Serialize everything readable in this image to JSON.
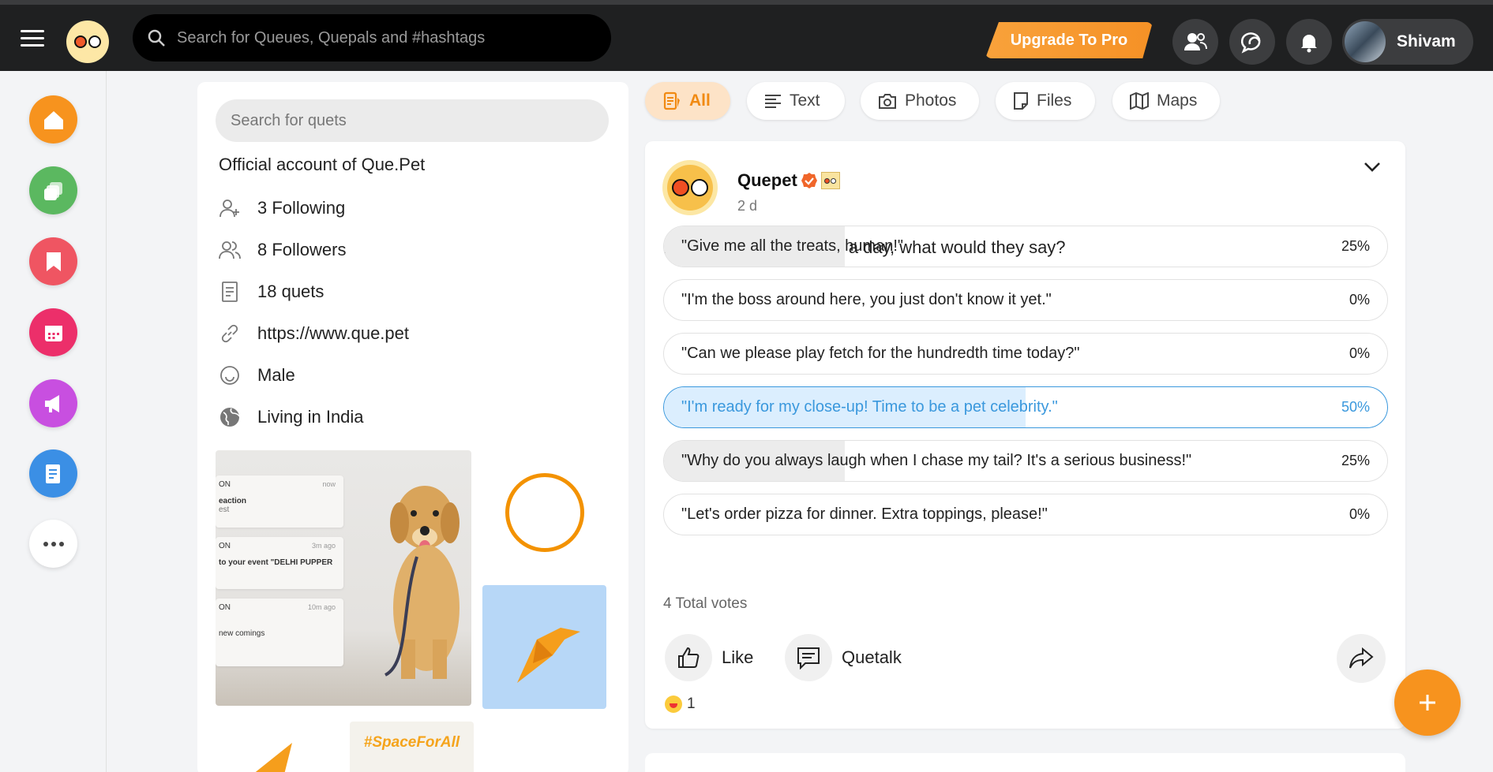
{
  "topbar": {
    "search_placeholder": "Search for Queues, Quepals and #hashtags",
    "upgrade_label": "Upgrade To Pro",
    "user_name": "Shivam"
  },
  "rail": {
    "items": [
      {
        "name": "home",
        "color": "#f7931e"
      },
      {
        "name": "queues",
        "color": "#4caf50"
      },
      {
        "name": "bookmarks",
        "color": "#ef4f5a"
      },
      {
        "name": "events",
        "color": "#ec2f6a"
      },
      {
        "name": "announcements",
        "color": "#c84fe0"
      },
      {
        "name": "news",
        "color": "#3b8fe5"
      },
      {
        "name": "more",
        "color": "#ffffff"
      }
    ]
  },
  "profile": {
    "search_placeholder": "Search for quets",
    "bio": "Official account of Que.Pet",
    "following": "3 Following",
    "followers": "8 Followers",
    "quets": "18 quets",
    "website": "https://www.que.pet",
    "gender": "Male",
    "location": "Living in India",
    "media": {
      "notifications": [
        {
          "title": "ON",
          "body": "eaction",
          "sub": "est",
          "time": "now"
        },
        {
          "title": "ON",
          "body": "to your event \"DELHI PUPPER",
          "sub": "",
          "time": "3m ago"
        },
        {
          "title": "ON",
          "body": "new comings",
          "sub": "",
          "time": "10m ago"
        }
      ],
      "space_tag": "#SpaceForAll"
    }
  },
  "filters": {
    "all": "All",
    "text": "Text",
    "photos": "Photos",
    "files": "Files",
    "maps": "Maps"
  },
  "post": {
    "author": "Quepet",
    "time": "2 d",
    "question": "If your pet could talk for a day, what would they say?",
    "options": [
      {
        "text": "\"Give me all the treats, human!\"",
        "pct": "25%",
        "value": 0.25,
        "selected": false
      },
      {
        "text": "\"I'm the boss around here, you just don't know it yet.\"",
        "pct": "0%",
        "value": 0,
        "selected": false
      },
      {
        "text": "\"Can we please play fetch for the hundredth time today?\"",
        "pct": "0%",
        "value": 0,
        "selected": false
      },
      {
        "text": "\"I'm ready for my close-up! Time to be a pet celebrity.\"",
        "pct": "50%",
        "value": 0.5,
        "selected": true
      },
      {
        "text": "\"Why do you always laugh when I chase my tail? It's a serious business!\"",
        "pct": "25%",
        "value": 0.25,
        "selected": false
      },
      {
        "text": "\"Let's order pizza for dinner. Extra toppings, please!\"",
        "pct": "0%",
        "value": 0,
        "selected": false
      }
    ],
    "total_votes": "4 Total votes",
    "like_label": "Like",
    "quetalk_label": "Quetalk",
    "reaction_count": "1"
  },
  "colors": {
    "accent": "#f7931e",
    "selected_blue": "#3a98dd"
  }
}
